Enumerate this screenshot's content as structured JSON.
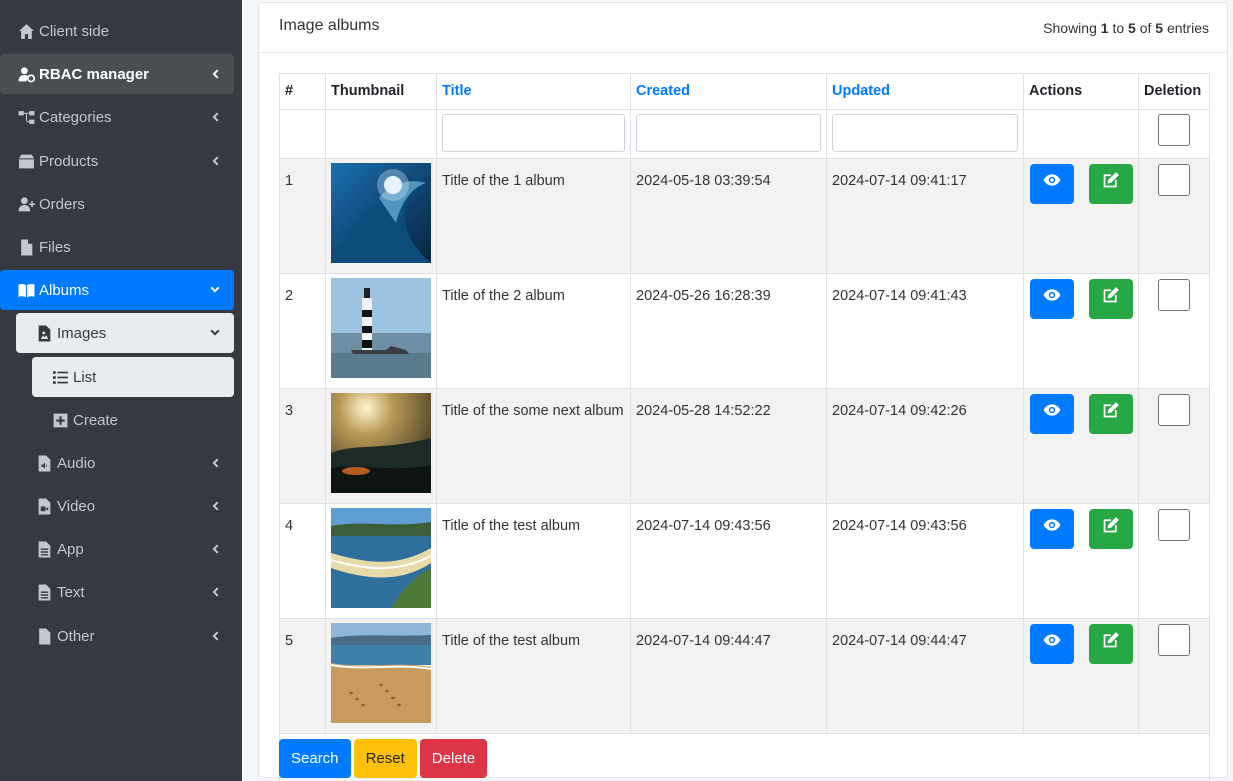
{
  "sidebar": {
    "items": [
      {
        "label": "Client side"
      },
      {
        "label": "RBAC manager"
      },
      {
        "label": "Categories"
      },
      {
        "label": "Products"
      },
      {
        "label": "Orders"
      },
      {
        "label": "Files"
      },
      {
        "label": "Albums"
      },
      {
        "label": "Images"
      },
      {
        "label": "List"
      },
      {
        "label": "Create"
      },
      {
        "label": "Audio"
      },
      {
        "label": "Video"
      },
      {
        "label": "App"
      },
      {
        "label": "Text"
      },
      {
        "label": "Other"
      }
    ]
  },
  "card": {
    "title": "Image albums",
    "summary": {
      "prefix": "Showing",
      "from": "1",
      "to_word": "to",
      "to": "5",
      "of_word": "of",
      "total": "5",
      "suffix": "entries"
    }
  },
  "table": {
    "headers": [
      "#",
      "Thumbnail",
      "Title",
      "Created",
      "Updated",
      "Actions",
      "Deletion"
    ],
    "rows": [
      {
        "num": "1",
        "title": "Title of the 1 album",
        "created": "2024-05-18 03:39:54",
        "updated": "2024-07-14 09:41:17"
      },
      {
        "num": "2",
        "title": "Title of the 2 album",
        "created": "2024-05-26 16:28:39",
        "updated": "2024-07-14 09:41:43"
      },
      {
        "num": "3",
        "title": "Title of the some next album",
        "created": "2024-05-28 14:52:22",
        "updated": "2024-07-14 09:42:26"
      },
      {
        "num": "4",
        "title": "Title of the test album",
        "created": "2024-07-14 09:43:56",
        "updated": "2024-07-14 09:43:56"
      },
      {
        "num": "5",
        "title": "Title of the test album",
        "created": "2024-07-14 09:44:47",
        "updated": "2024-07-14 09:44:47"
      }
    ]
  },
  "buttons": {
    "search": "Search",
    "reset": "Reset",
    "delete": "Delete"
  },
  "colors": {
    "primary": "#007bff",
    "success": "#28a745",
    "warning": "#ffc107",
    "danger": "#dc3545",
    "sidebar": "#343a40"
  }
}
